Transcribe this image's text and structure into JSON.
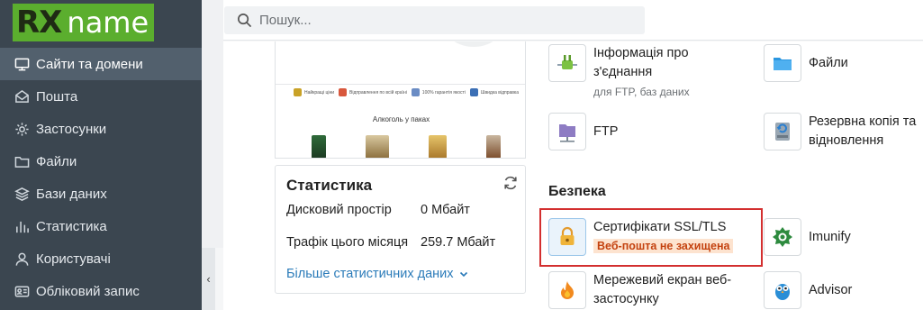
{
  "logo": {
    "rx": "RX",
    "name": "name"
  },
  "search": {
    "placeholder": "Пошук..."
  },
  "sidebar": {
    "items": [
      {
        "label": "Сайти та домени",
        "icon": "monitor-icon",
        "active": true
      },
      {
        "label": "Пошта",
        "icon": "mail-icon",
        "active": false
      },
      {
        "label": "Застосунки",
        "icon": "gear-icon",
        "active": false
      },
      {
        "label": "Файли",
        "icon": "folder-icon",
        "active": false
      },
      {
        "label": "Бази даних",
        "icon": "layers-icon",
        "active": false
      },
      {
        "label": "Статистика",
        "icon": "bar-chart-icon",
        "active": false
      },
      {
        "label": "Користувачі",
        "icon": "user-icon",
        "active": false
      },
      {
        "label": "Обліковий запис",
        "icon": "id-card-icon",
        "active": false
      }
    ],
    "collapse": "‹"
  },
  "preview": {
    "features": [
      "Найкращі ціни",
      "Відправлення по всій країні",
      "100% гарантія якості",
      "Швидка відправка"
    ],
    "promo_title": "Алкоголь у паках"
  },
  "stats": {
    "title": "Статистика",
    "rows": [
      {
        "label": "Дисковий простір",
        "value": "0 Мбайт"
      },
      {
        "label": "Трафік цього місяця",
        "value": "259.7 Мбайт"
      }
    ],
    "more": "Більше статистичних даних"
  },
  "tools": {
    "ftp_info": {
      "name": "Інформація про з'єднання",
      "sub": "для FTP, баз даних"
    },
    "files": {
      "name": "Файли"
    },
    "ftp": {
      "name": "FTP"
    },
    "backup": {
      "name": "Резервна копія та відновлення"
    },
    "security_title": "Безпека",
    "ssl": {
      "name": "Сертифікати SSL/TLS",
      "badge": "Веб-пошта не захищена"
    },
    "imunify": {
      "name": "Imunify"
    },
    "firewall": {
      "name": "Мережевий екран веб-застосунку"
    },
    "advisor": {
      "name": "Advisor"
    }
  },
  "colors": {
    "sidebar": "#3b4650",
    "accent": "#5bae2e",
    "link": "#2b7bb9",
    "alert": "#d32f2f"
  }
}
